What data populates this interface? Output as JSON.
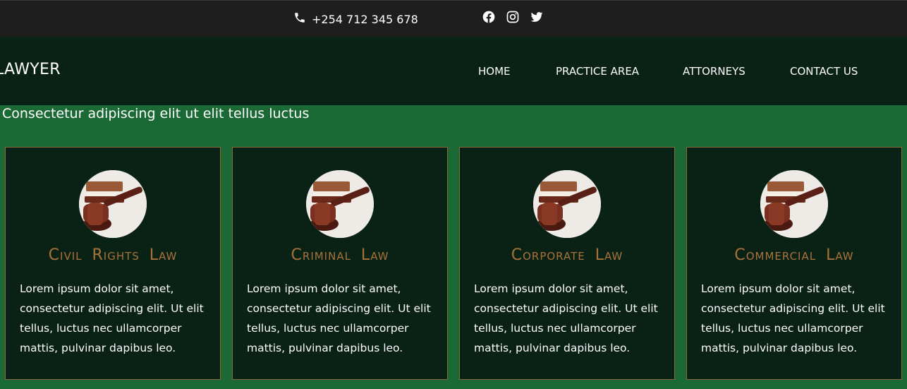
{
  "topbar": {
    "phone": "+254 712 345 678",
    "icons": [
      "phone-icon",
      "facebook-icon",
      "instagram-icon",
      "twitter-icon"
    ]
  },
  "header": {
    "logo": "LAWYER",
    "nav": [
      {
        "label": "HOME"
      },
      {
        "label": "PRACTICE AREA"
      },
      {
        "label": "ATTORNEYS"
      },
      {
        "label": "CONTACT US"
      }
    ]
  },
  "tagline": "Consectetur adipiscing elit ut elit tellus luctus",
  "practice_areas": [
    {
      "title": "Civil Rights Law",
      "text": "Lorem ipsum dolor sit amet, consectetur adipiscing elit. Ut elit tellus, luctus nec ullamcorper mattis, pulvinar dapibus leo."
    },
    {
      "title": "Criminal Law",
      "text": "Lorem ipsum dolor sit amet, consectetur adipiscing elit. Ut elit tellus, luctus nec ullamcorper mattis, pulvinar dapibus leo."
    },
    {
      "title": "Corporate Law",
      "text": "Lorem ipsum dolor sit amet, consectetur adipiscing elit. Ut elit tellus, luctus nec ullamcorper mattis, pulvinar dapibus leo."
    },
    {
      "title": "Commercial Law",
      "text": "Lorem ipsum dolor sit amet, consectetur adipiscing elit. Ut elit tellus, luctus nec ullamcorper mattis, pulvinar dapibus leo."
    }
  ],
  "colors": {
    "topbar": "#1e1e1e",
    "navbar": "#0a2116",
    "background": "#1b6a35",
    "card": "#0a2116",
    "accent": "#a8733a"
  }
}
